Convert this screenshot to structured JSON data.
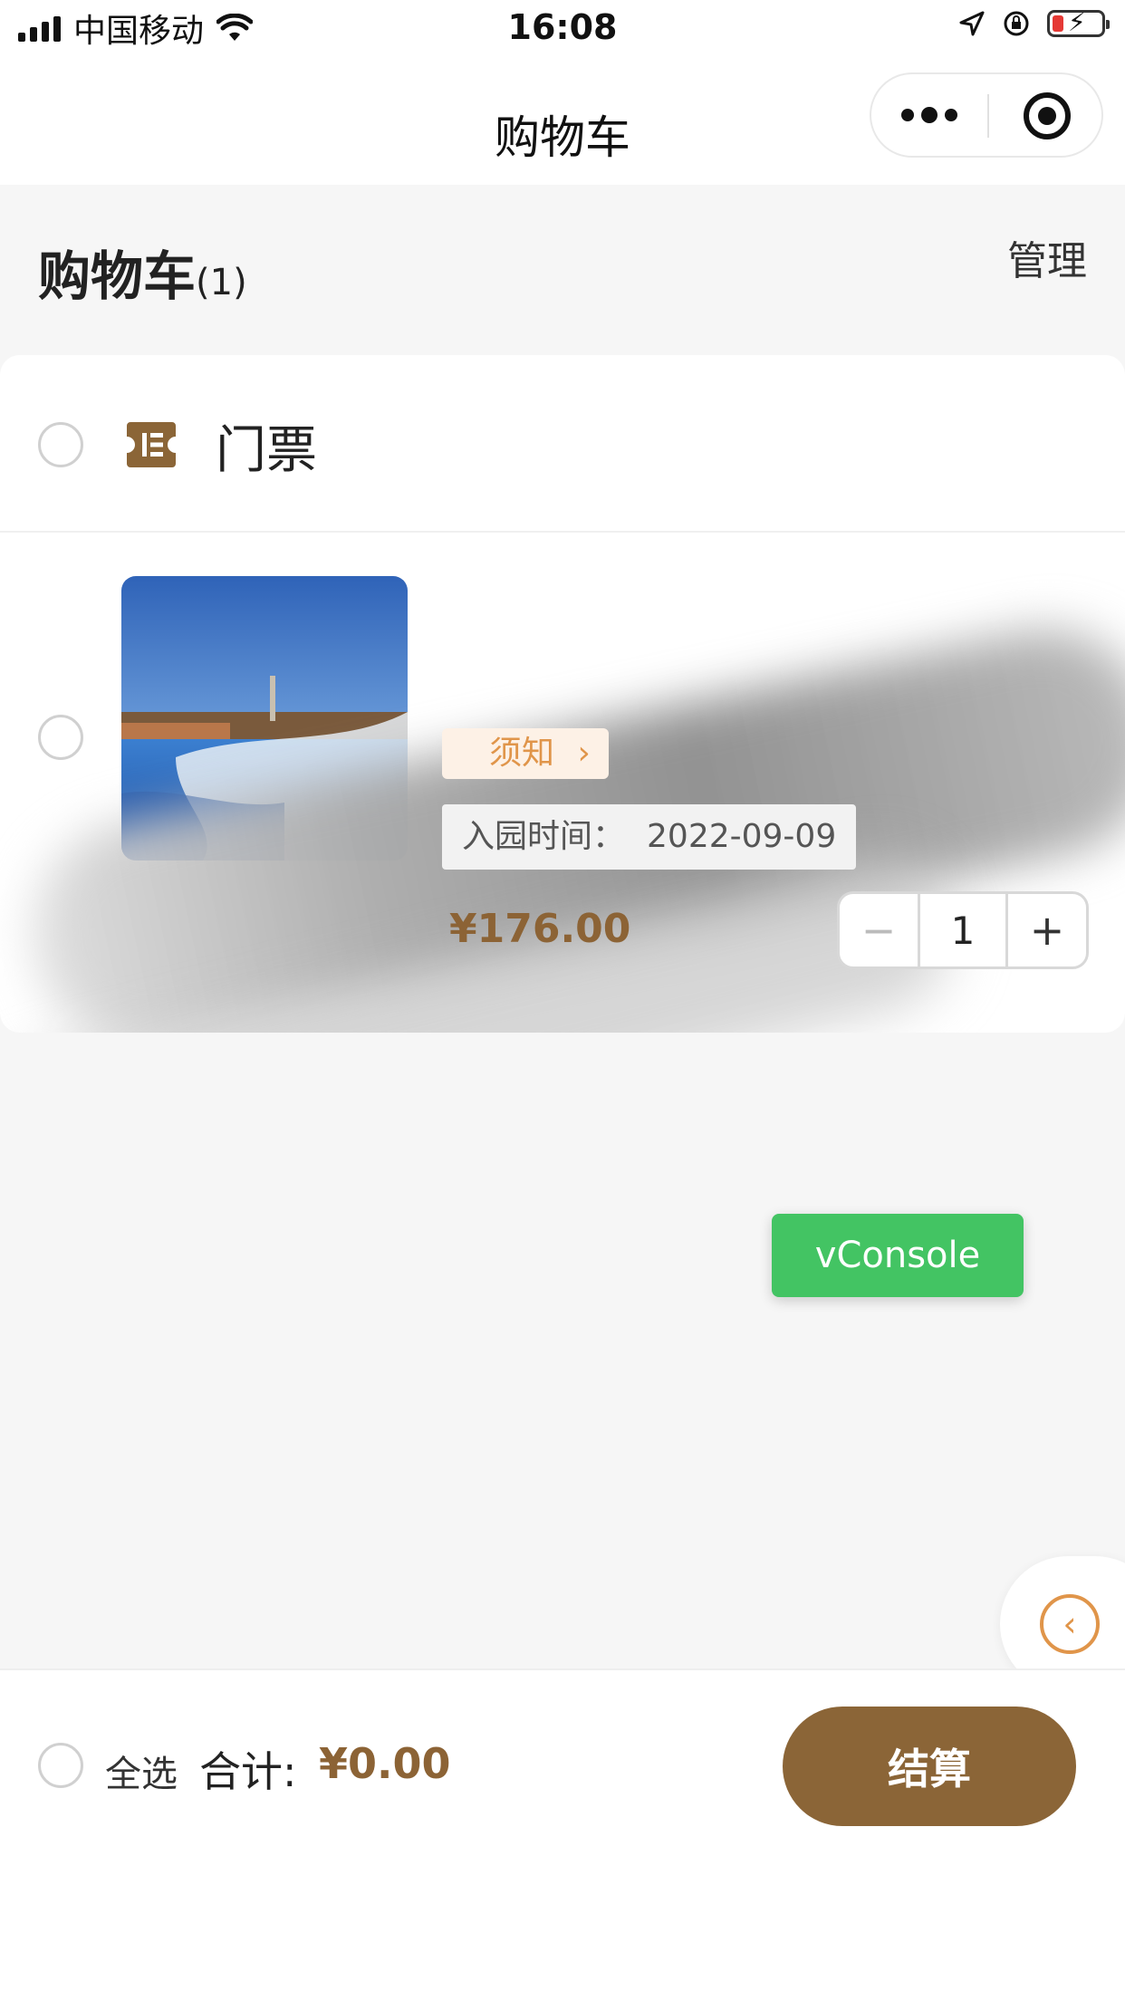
{
  "status_bar": {
    "carrier": "中国移动",
    "time": "16:08",
    "icons": [
      "signal-icon",
      "wifi-icon",
      "location-icon",
      "orientation-lock-icon",
      "battery-charging-icon"
    ]
  },
  "nav": {
    "title": "购物车",
    "more_icon": "more-dots-icon",
    "close_icon": "target-close-icon"
  },
  "header": {
    "title": "购物车",
    "count": "(1)",
    "manage": "管理"
  },
  "cart": {
    "shop": {
      "icon": "ticket-icon",
      "name": "门票"
    },
    "item": {
      "notice_label": "须知",
      "visit_label": "入园时间：",
      "visit_date": "2022-09-09",
      "price": "¥176.00",
      "quantity": "1",
      "minus": "−",
      "plus": "+"
    }
  },
  "vconsole": {
    "label": "vConsole"
  },
  "float_back": {
    "icon": "chevron-left-icon",
    "glyph": "‹"
  },
  "footer": {
    "select_all": "全选",
    "total_label": "合计:",
    "total_value": "¥0.00",
    "checkout": "结算"
  },
  "colors": {
    "brand_brown": "#8b6537",
    "price_brown": "#8c6335",
    "accent_orange": "#e0954a",
    "vconsole_green": "#43c463"
  }
}
